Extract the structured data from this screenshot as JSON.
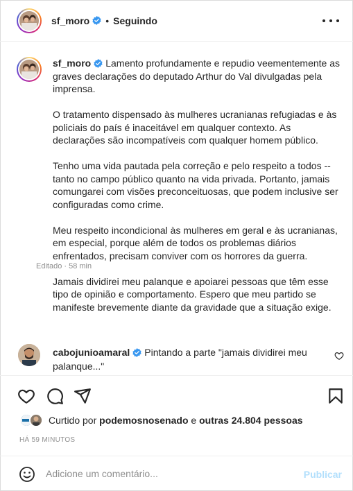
{
  "header": {
    "username": "sf_moro",
    "separator": "•",
    "follow_status": "Seguindo"
  },
  "caption": {
    "username": "sf_moro",
    "paragraphs": [
      "Lamento profundamente e repudio veementemente as graves declarações do deputado Arthur do Val divulgadas pela imprensa.",
      "O tratamento dispensado às mulheres ucranianas refugiadas e às policiais do país é inaceitável em qualquer contexto. As declarações são incompatíveis com qualquer homem público.",
      "Tenho uma vida pautada pela correção e pelo respeito a todos -- tanto no campo público quanto na vida privada. Portanto, jamais comungarei com visões preconceituosas, que podem inclusive ser configuradas como crime.",
      "Meu respeito incondicional às mulheres em geral e às ucranianas, em especial, porque além de todos os problemas diários enfrentados, precisam conviver com os horrores da guerra.",
      "Jamais dividirei meu palanque e apoiarei pessoas que têm esse tipo de opinião e comportamento. Espero que meu partido se manifeste brevemente diante da gravidade que a situação exige."
    ],
    "meta": "Editado · 58 min"
  },
  "comment": {
    "username": "cabojunioamaral",
    "text": "Pintando a parte \"jamais dividirei meu palanque...\""
  },
  "likes": {
    "prefix": "Curtido por ",
    "user": "podemosnosenado",
    "middle": " e ",
    "others": "outras 24.804 pessoas"
  },
  "timestamp": "HÁ 59 MINUTOS",
  "add_comment": {
    "placeholder": "Adicione um comentário...",
    "publish_label": "Publicar"
  },
  "colors": {
    "verified": "#3897f0",
    "publish_disabled": "#b2dffc",
    "secondary_text": "#8e8e8e"
  }
}
